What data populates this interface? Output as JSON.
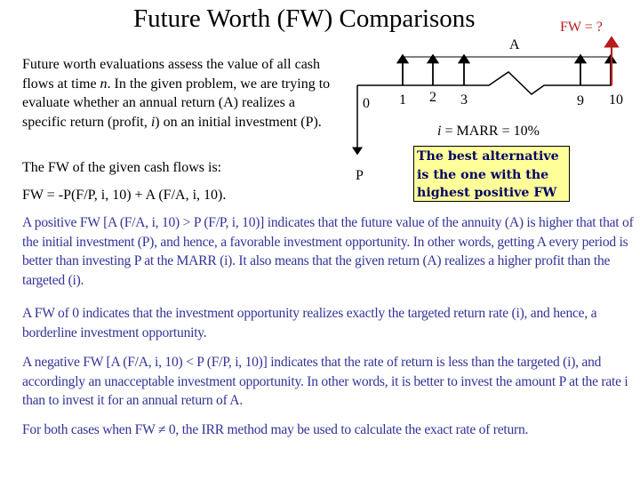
{
  "title": "Future Worth (FW) Comparisons",
  "diagram": {
    "fw_label": "FW = ?",
    "annuity_label": "A",
    "present_label": "P",
    "periods": [
      "0",
      "1",
      "2",
      "3",
      "9",
      "10"
    ],
    "rate_label_var": "i",
    "rate_label_rest": " = MARR = 10%",
    "callout": "The best alternative is the one with the highest positive FW",
    "colors": {
      "fw_arrow": "#b71c1c",
      "callout_bg": "#ffff99",
      "callout_text": "#000066"
    }
  },
  "intro": {
    "text_a": "Future worth evaluations assess the value of all cash flows at time ",
    "n": "n",
    "text_b": ".  In the given problem, we are trying to evaluate whether an annual return (A) realizes a specific return (profit, ",
    "i": "i",
    "text_c": ") on an initial investment (P).",
    "fw_statement": "The FW of the given cash flows is:",
    "formula": "FW = -P(F/P, i, 10) + A (F/A, i, 10)."
  },
  "paragraphs": {
    "positive": "A positive FW [A (F/A, i, 10) > P (F/P, i, 10)] indicates that the future value of the annuity (A) is higher that that of the initial investment (P), and hence, a favorable investment opportunity. In other words, getting A every period is better than investing P at the MARR (i).  It also means that the given return (A) realizes a higher profit than the targeted (i).",
    "zero": "A FW of 0 indicates that the investment opportunity realizes exactly the targeted return rate (i), and hence, a borderline investment opportunity.",
    "negative": "A negative FW [A (F/A, i, 10) < P (F/P, i, 10)] indicates that the rate of return is less than the targeted (i), and accordingly an unacceptable investment opportunity.  In other words, it is better to invest the amount P at the rate i than to invest it for an annual return of A.",
    "irr": "For both cases when FW ≠ 0, the IRR method may be used to calculate the exact rate of return."
  },
  "colors": {
    "body_text": "#333399"
  }
}
